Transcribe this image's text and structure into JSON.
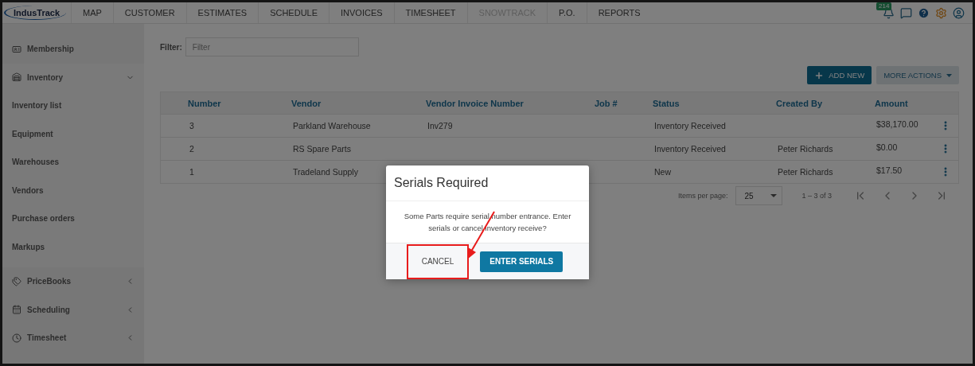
{
  "nav": {
    "logo": "IndusTrack",
    "items": [
      {
        "label": "MAP",
        "disabled": false
      },
      {
        "label": "CUSTOMER",
        "disabled": false
      },
      {
        "label": "ESTIMATES",
        "disabled": false
      },
      {
        "label": "SCHEDULE",
        "disabled": false
      },
      {
        "label": "INVOICES",
        "disabled": false
      },
      {
        "label": "TIMESHEET",
        "disabled": false
      },
      {
        "label": "SNOWTRACK",
        "disabled": true
      },
      {
        "label": "P.O.",
        "disabled": false
      },
      {
        "label": "REPORTS",
        "disabled": false
      }
    ],
    "notification_count": "214"
  },
  "sidebar": {
    "items": [
      {
        "label": "Membership",
        "kind": "link"
      },
      {
        "label": "Inventory",
        "kind": "group",
        "expanded": true,
        "children": [
          {
            "label": "Inventory list"
          },
          {
            "label": "Equipment"
          },
          {
            "label": "Warehouses"
          },
          {
            "label": "Vendors"
          },
          {
            "label": "Purchase orders"
          },
          {
            "label": "Markups"
          }
        ]
      },
      {
        "label": "PriceBooks",
        "kind": "group",
        "expanded": false
      },
      {
        "label": "Scheduling",
        "kind": "group",
        "expanded": false
      },
      {
        "label": "Timesheet",
        "kind": "group",
        "expanded": false
      }
    ]
  },
  "filter": {
    "label": "Filter:",
    "placeholder": "Filter"
  },
  "actions": [
    {
      "label": "ADD NEW",
      "kind": "primary"
    },
    {
      "label": "MORE ACTIONS",
      "kind": "menu"
    }
  ],
  "table": {
    "columns": [
      "Number",
      "Vendor",
      "Vendor Invoice Number",
      "Job #",
      "Status",
      "Created By",
      "Amount"
    ],
    "rows": [
      {
        "cells": [
          "3",
          "Parkland Warehouse",
          "Inv279",
          "",
          "Inventory Received",
          "",
          "$38,170.00"
        ]
      },
      {
        "cells": [
          "2",
          "RS Spare Parts",
          "",
          "",
          "Inventory Received",
          "Peter Richards",
          "$0.00"
        ]
      },
      {
        "cells": [
          "1",
          "Tradeland Supply",
          "",
          "",
          "New",
          "Peter Richards",
          "$17.50"
        ]
      }
    ]
  },
  "pagination": {
    "items_per_page_label": "Items per page:",
    "items_per_page": "25",
    "range": "1 – 3 of 3"
  },
  "dialog": {
    "title": "Serials Required",
    "message": "Some Parts require serial number entrance. Enter serials or cancel inventory receive?",
    "buttons": [
      {
        "label": "CANCEL",
        "kind": "secondary",
        "highlighted": true
      },
      {
        "label": "ENTER SERIALS",
        "kind": "primary",
        "highlighted": false
      }
    ]
  }
}
